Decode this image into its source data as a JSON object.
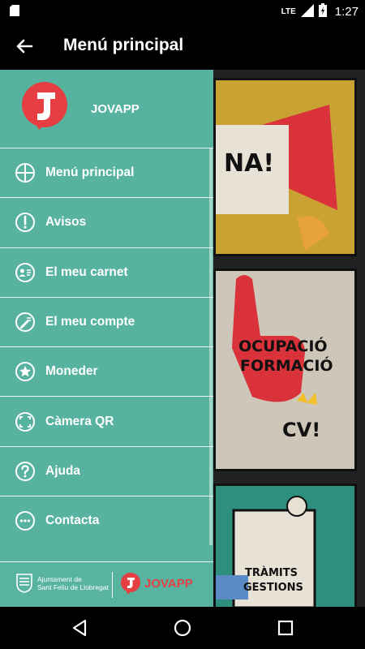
{
  "status_bar": {
    "network": "LTE",
    "time": "1:27"
  },
  "app_bar": {
    "title": "Menú principal"
  },
  "drawer": {
    "app_name": "JOVAPP",
    "items": [
      {
        "label": "Menú principal",
        "icon": "globe-icon"
      },
      {
        "label": "Avisos",
        "icon": "exclamation-icon"
      },
      {
        "label": "El meu carnet",
        "icon": "id-card-icon"
      },
      {
        "label": "El meu compte",
        "icon": "account-edit-icon"
      },
      {
        "label": "Moneder",
        "icon": "star-badge-icon"
      },
      {
        "label": "Càmera QR",
        "icon": "qr-scan-icon"
      },
      {
        "label": "Ajuda",
        "icon": "question-icon"
      },
      {
        "label": "Contacta",
        "icon": "chat-bubble-icon"
      }
    ],
    "footer": {
      "ajuntament_line1": "Ajuntament de",
      "ajuntament_line2": "Sant Feliu de Llobregat",
      "brand_jov": "JOV",
      "brand_app": "APP"
    }
  },
  "background": {
    "panel1_text": "NA!",
    "panel2_text_line1": "OCUPACIÓ",
    "panel2_text_line2": "FORMACIÓ",
    "panel2_text_cv": "CV!",
    "panel3_text_line1": "TRÀMITS",
    "panel3_text_line2": "GESTIONS"
  },
  "colors": {
    "drawer": "#57b39f",
    "brand_red": "#e53f43",
    "panel_yellow": "#c9a233"
  }
}
